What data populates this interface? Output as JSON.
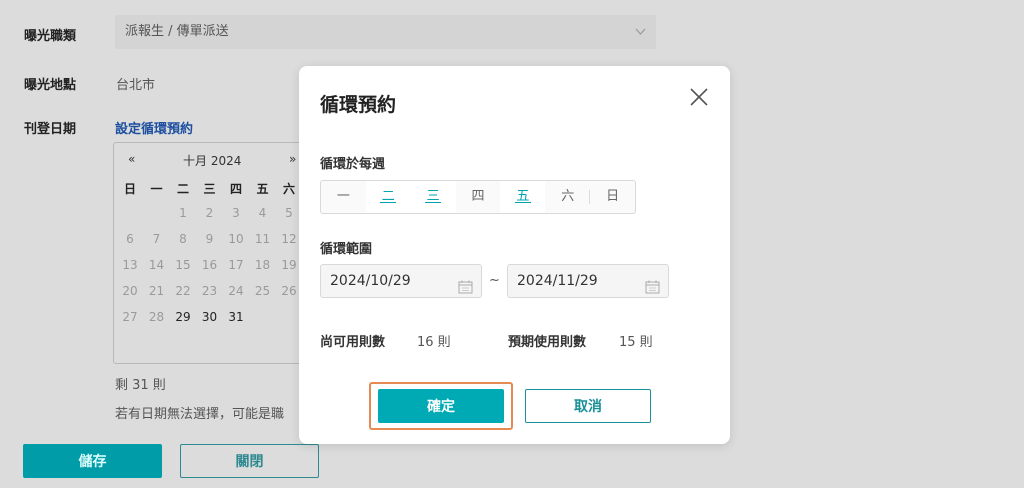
{
  "form": {
    "job_type_label": "曝光職類",
    "job_type_value": "派報生 / 傳單派送",
    "location_label": "曝光地點",
    "location_value": "台北市",
    "date_label": "刊登日期",
    "recurring_link": "設定循環預約",
    "calendar": {
      "prev": "«",
      "next": "»",
      "month": "十月 2024",
      "weekdays": [
        "日",
        "一",
        "二",
        "三",
        "四",
        "五",
        "六"
      ],
      "rows": [
        [
          "",
          "",
          "1",
          "2",
          "3",
          "4",
          "5"
        ],
        [
          "6",
          "7",
          "8",
          "9",
          "10",
          "11",
          "12"
        ],
        [
          "13",
          "14",
          "15",
          "16",
          "17",
          "18",
          "19"
        ],
        [
          "20",
          "21",
          "22",
          "23",
          "24",
          "25",
          "26"
        ],
        [
          "27",
          "28",
          "29",
          "30",
          "31",
          "",
          ""
        ]
      ],
      "enabled": [
        "29",
        "30",
        "31"
      ]
    },
    "remaining": "剩 31 則",
    "note": "若有日期無法選擇，可能是職",
    "save_button": "儲存",
    "close_button": "關閉"
  },
  "modal": {
    "title": "循環預約",
    "weekly_label": "循環於每週",
    "weekdays": [
      {
        "label": "一",
        "selected": false
      },
      {
        "label": "二",
        "selected": true
      },
      {
        "label": "三",
        "selected": true
      },
      {
        "label": "四",
        "selected": false
      },
      {
        "label": "五",
        "selected": true
      },
      {
        "label": "六",
        "selected": false
      },
      {
        "label": "日",
        "selected": false
      }
    ],
    "range_label": "循環範圍",
    "start_date": "2024/10/29",
    "end_date": "2024/11/29",
    "tilde": "~",
    "available_label": "尚可用則數",
    "available_value": "16 則",
    "expected_label": "預期使用則數",
    "expected_value": "15 則",
    "confirm_button": "確定",
    "cancel_button": "取消"
  },
  "colors": {
    "accent": "#00aab5",
    "focus_ring": "#e58a55",
    "link": "#1c4fa0"
  }
}
